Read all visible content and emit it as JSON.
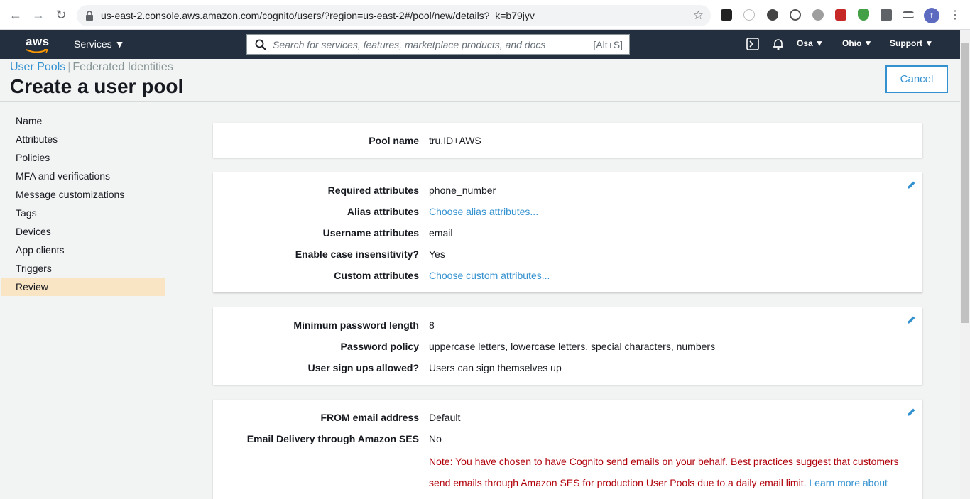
{
  "browser": {
    "url": "us-east-2.console.aws.amazon.com/cognito/users/?region=us-east-2#/pool/new/details?_k=b79jyv",
    "profile_initial": "t"
  },
  "awsnav": {
    "logo": "aws",
    "services_label": "Services",
    "search_placeholder": "Search for services, features, marketplace products, and docs",
    "search_hint": "[Alt+S]",
    "account_label": "Osa",
    "region_label": "Ohio",
    "support_label": "Support"
  },
  "header": {
    "tab_user_pools": "User Pools",
    "tab_federated": "Federated Identities",
    "title": "Create a user pool",
    "cancel_label": "Cancel"
  },
  "sidebar": {
    "items": [
      {
        "label": "Name"
      },
      {
        "label": "Attributes"
      },
      {
        "label": "Policies"
      },
      {
        "label": "MFA and verifications"
      },
      {
        "label": "Message customizations"
      },
      {
        "label": "Tags"
      },
      {
        "label": "Devices"
      },
      {
        "label": "App clients"
      },
      {
        "label": "Triggers"
      },
      {
        "label": "Review"
      }
    ],
    "active": "Review"
  },
  "review": {
    "pool": {
      "label": "Pool name",
      "value": "tru.ID+AWS"
    },
    "attributes": {
      "required_label": "Required attributes",
      "required_value": "phone_number",
      "alias_label": "Alias attributes",
      "alias_link": "Choose alias attributes...",
      "username_label": "Username attributes",
      "username_value": "email",
      "case_label": "Enable case insensitivity?",
      "case_value": "Yes",
      "custom_label": "Custom attributes",
      "custom_link": "Choose custom attributes..."
    },
    "policies": {
      "minlen_label": "Minimum password length",
      "minlen_value": "8",
      "policy_label": "Password policy",
      "policy_value": "uppercase letters, lowercase letters, special characters, numbers",
      "signup_label": "User sign ups allowed?",
      "signup_value": "Users can sign themselves up"
    },
    "email": {
      "from_label": "FROM email address",
      "from_value": "Default",
      "ses_label": "Email Delivery through Amazon SES",
      "ses_value": "No",
      "note_line1": "Note: You have chosen to have Cognito send emails on your behalf. Best practices suggest that customers",
      "note_line2": "send emails through Amazon SES for production User Pools due to a daily email limit.",
      "note_link": "Learn more about"
    }
  },
  "colors": {
    "aws_nav_bg": "#232f3e",
    "link": "#3391d0",
    "active_nav": "#f9e4c3",
    "warning_text": "#b0000a",
    "page_bg": "#f2f3f3"
  }
}
